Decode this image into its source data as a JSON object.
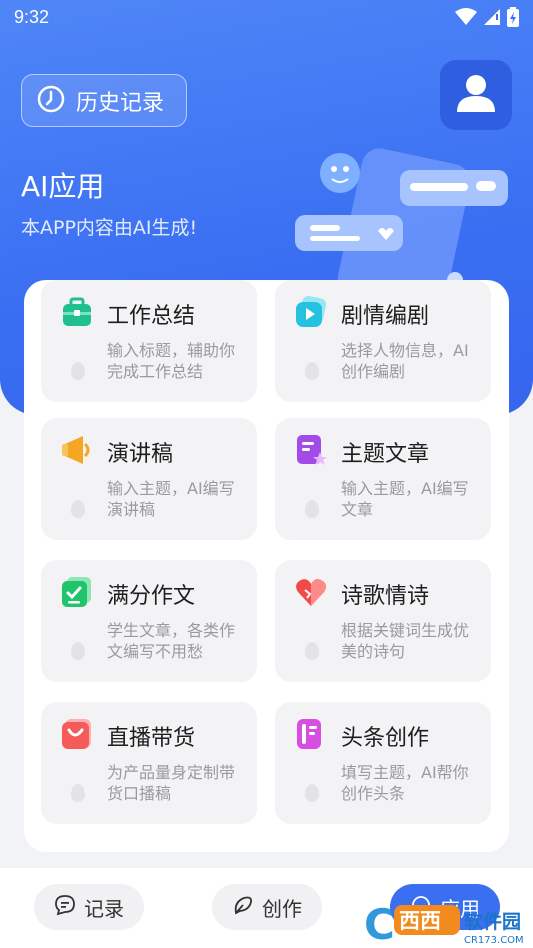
{
  "status": {
    "time": "9:32"
  },
  "header": {
    "history_label": "历史记录",
    "app_title": "AI应用",
    "subtitle": "本APP内容由AI生成!"
  },
  "cards": [
    {
      "title": "工作总结",
      "desc": "输入标题，辅助你完成工作总结",
      "icon": "briefcase-icon",
      "color": "#1fbf8f"
    },
    {
      "title": "剧情编剧",
      "desc": "选择人物信息，AI创作编剧",
      "icon": "play-icon",
      "color": "#24c2e0"
    },
    {
      "title": "演讲稿",
      "desc": "输入主题，AI编写演讲稿",
      "icon": "megaphone-icon",
      "color": "#f5a623"
    },
    {
      "title": "主题文章",
      "desc": "输入主题，AI编写文章",
      "icon": "document-star-icon",
      "color": "#a24be8"
    },
    {
      "title": "满分作文",
      "desc": "学生文章，各类作文编写不用愁",
      "icon": "checklist-icon",
      "color": "#1fc46b"
    },
    {
      "title": "诗歌情诗",
      "desc": "根据关键词生成优美的诗句",
      "icon": "heart-icon",
      "color": "#f04a4a"
    },
    {
      "title": "直播带货",
      "desc": "为产品量身定制带货口播稿",
      "icon": "shopping-bag-icon",
      "color": "#f45b5b"
    },
    {
      "title": "头条创作",
      "desc": "填写主题，AI帮你创作头条",
      "icon": "pen-card-icon",
      "color": "#d64fe0"
    }
  ],
  "bottom_nav": {
    "record_label": "记录",
    "create_label": "创作",
    "apps_label": "应用"
  },
  "watermark": {
    "text": "西西软件园",
    "sub": "CR173.COM"
  }
}
